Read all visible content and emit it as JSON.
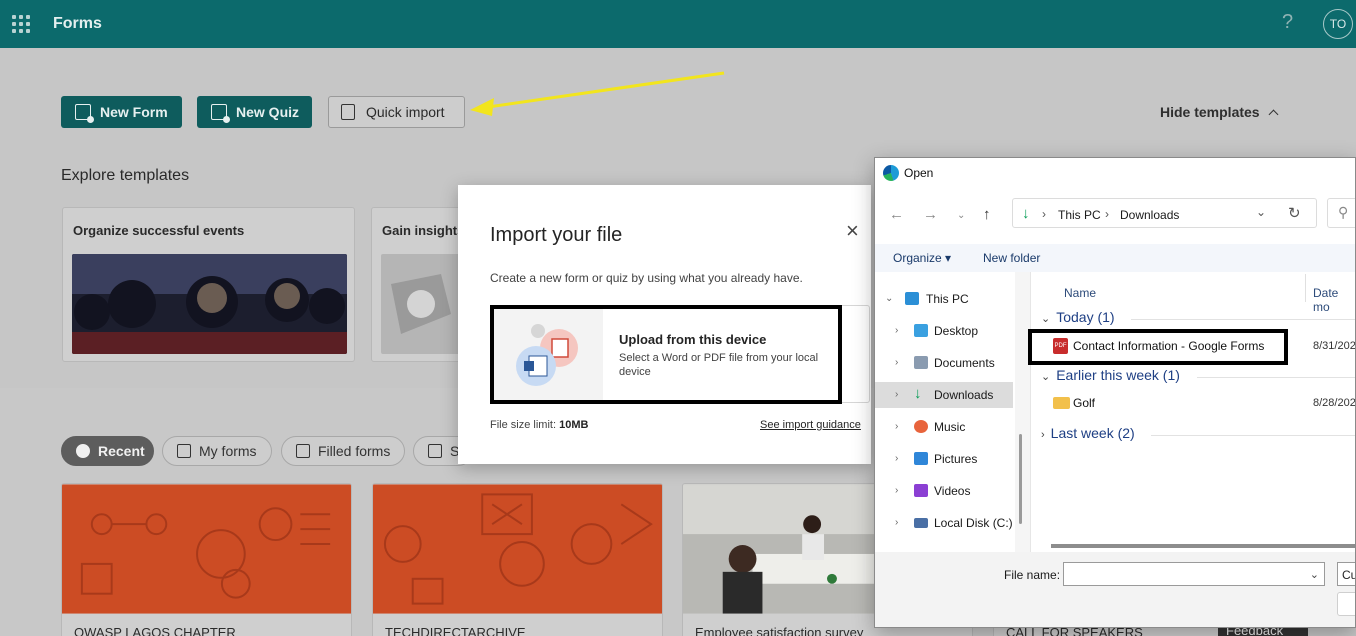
{
  "app": {
    "title": "Forms",
    "help_label": "?",
    "avatar_initials": "TO"
  },
  "actions": {
    "new_form": "New Form",
    "new_quiz": "New Quiz",
    "quick_import": "Quick import",
    "hide_templates": "Hide templates"
  },
  "templates": {
    "heading": "Explore templates",
    "cards": [
      {
        "title": "Organize successful events"
      },
      {
        "title": "Gain insights"
      }
    ]
  },
  "filters": {
    "tabs": [
      {
        "label": "Recent",
        "active": true
      },
      {
        "label": "My forms",
        "active": false
      },
      {
        "label": "Filled forms",
        "active": false
      },
      {
        "label": "S",
        "active": false
      }
    ]
  },
  "recent_forms": [
    {
      "title": "OWASP LAGOS CHAPTER"
    },
    {
      "title": "TECHDIRECTARCHIVE"
    },
    {
      "title": "Employee satisfaction survey"
    },
    {
      "title": "CALL FOR SPEAKERS"
    }
  ],
  "feedback_label": "Feedback",
  "import_dialog": {
    "title": "Import your file",
    "close_label": "×",
    "description": "Create a new form or quiz by using what you already have.",
    "upload_title": "Upload from this device",
    "upload_description": "Select a Word or PDF file from your local device",
    "size_limit_label": "File size limit:",
    "size_limit_value": "10MB",
    "guidance_link": "See import guidance"
  },
  "open_dialog": {
    "title": "Open",
    "breadcrumb": [
      "This PC",
      "Downloads"
    ],
    "organize": "Organize",
    "new_folder": "New folder",
    "nav_items": [
      {
        "label": "This PC",
        "icon": "monitor-icon",
        "color": "#2b8fd6"
      },
      {
        "label": "Desktop",
        "icon": "desktop-icon",
        "color": "#3aa0e0"
      },
      {
        "label": "Documents",
        "icon": "documents-icon",
        "color": "#8a9bb0"
      },
      {
        "label": "Downloads",
        "icon": "downloads-icon",
        "color": "#0a9d58"
      },
      {
        "label": "Music",
        "icon": "music-icon",
        "color": "#e8643c"
      },
      {
        "label": "Pictures",
        "icon": "pictures-icon",
        "color": "#2f86d8"
      },
      {
        "label": "Videos",
        "icon": "videos-icon",
        "color": "#8b3fd3"
      },
      {
        "label": "Local Disk (C:)",
        "icon": "disk-icon",
        "color": "#4a6fa5"
      }
    ],
    "columns": {
      "name": "Name",
      "date": "Date mo"
    },
    "groups": [
      {
        "label": "Today (1)",
        "files": [
          {
            "name": "Contact Information - Google Forms",
            "type": "pdf",
            "date": "8/31/202"
          }
        ]
      },
      {
        "label": "Earlier this week (1)",
        "files": [
          {
            "name": "Golf",
            "type": "folder",
            "date": "8/28/202"
          }
        ]
      },
      {
        "label": "Last week (2)",
        "files": []
      }
    ],
    "file_name_label": "File name:",
    "file_name_value": "",
    "file_type_stub": "Cu"
  },
  "colors": {
    "app_bar": "#0c6a6c",
    "primary_button": "#0e5c5d",
    "form_card_orange": "#cc4c24",
    "annotation_arrow": "#f2e51d"
  }
}
